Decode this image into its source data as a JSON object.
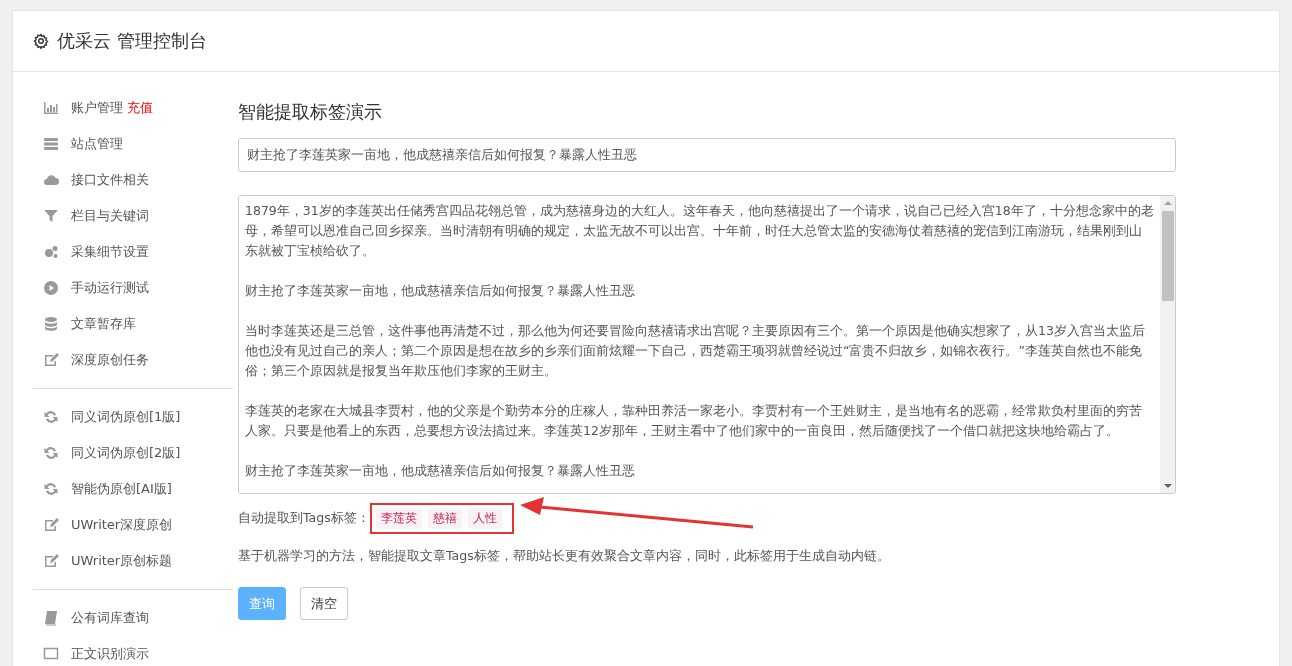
{
  "header": {
    "title": "优采云 管理控制台"
  },
  "sidebar": {
    "groups": [
      {
        "items": [
          {
            "label": "账户管理",
            "badge": "充值"
          },
          {
            "label": "站点管理"
          },
          {
            "label": "接口文件相关"
          },
          {
            "label": "栏目与关键词"
          },
          {
            "label": "采集细节设置"
          },
          {
            "label": "手动运行测试"
          },
          {
            "label": "文章暂存库"
          },
          {
            "label": "深度原创任务"
          }
        ]
      },
      {
        "items": [
          {
            "label": "同义词伪原创[1版]"
          },
          {
            "label": "同义词伪原创[2版]"
          },
          {
            "label": "智能伪原创[AI版]"
          },
          {
            "label": "UWriter深度原创"
          },
          {
            "label": "UWriter原创标题"
          }
        ]
      },
      {
        "items": [
          {
            "label": "公有词库查询"
          },
          {
            "label": "正文识别演示"
          }
        ]
      }
    ]
  },
  "main": {
    "title": "智能提取标签演示",
    "title_field": {
      "value": "财主抢了李莲英家一亩地，他成慈禧亲信后如何报复？暴露人性丑恶"
    },
    "article_field": {
      "paragraphs": [
        "1879年，31岁的李莲英出任储秀宫四品花翎总管，成为慈禧身边的大红人。这年春天，他向慈禧提出了一个请求，说自己已经入宫18年了，十分想念家中的老母，希望可以恩准自己回乡探亲。当时清朝有明确的规定，太监无故不可以出宫。十年前，时任大总管太监的安德海仗着慈禧的宠信到江南游玩，结果刚到山东就被丁宝桢给砍了。",
        "财主抢了李莲英家一亩地，他成慈禧亲信后如何报复？暴露人性丑恶",
        "当时李莲英还是三总管，这件事他再清楚不过，那么他为何还要冒险向慈禧请求出宫呢？主要原因有三个。第一个原因是他确实想家了，从13岁入宫当太监后他也没有见过自己的亲人；第二个原因是想在故乡的乡亲们面前炫耀一下自己，西楚霸王项羽就曾经说过“富贵不归故乡，如锦衣夜行。”李莲英自然也不能免俗；第三个原因就是报复当年欺压他们李家的王财主。",
        "李莲英的老家在大城县李贾村，他的父亲是个勤劳本分的庄稼人，靠种田养活一家老小。李贾村有一个王姓财主，是当地有名的恶霸，经常欺负村里面的穷苦人家。只要是他看上的东西，总要想方设法搞过来。李莲英12岁那年，王财主看中了他们家中的一亩良田，然后随便找了一个借口就把这块地给霸占了。",
        "财主抢了李莲英家一亩地，他成慈禧亲信后如何报复？暴露人性丑恶"
      ]
    },
    "tags_label": "自动提取到Tags标签：",
    "tags": [
      "李莲英",
      "慈禧",
      "人性"
    ],
    "description": "基于机器学习的方法，智能提取文章Tags标签，帮助站长更有效聚合文章内容，同时，此标签用于生成自动内链。",
    "buttons": [
      {
        "label": "查询",
        "kind": "primary"
      },
      {
        "label": "清空",
        "kind": "default"
      }
    ]
  }
}
